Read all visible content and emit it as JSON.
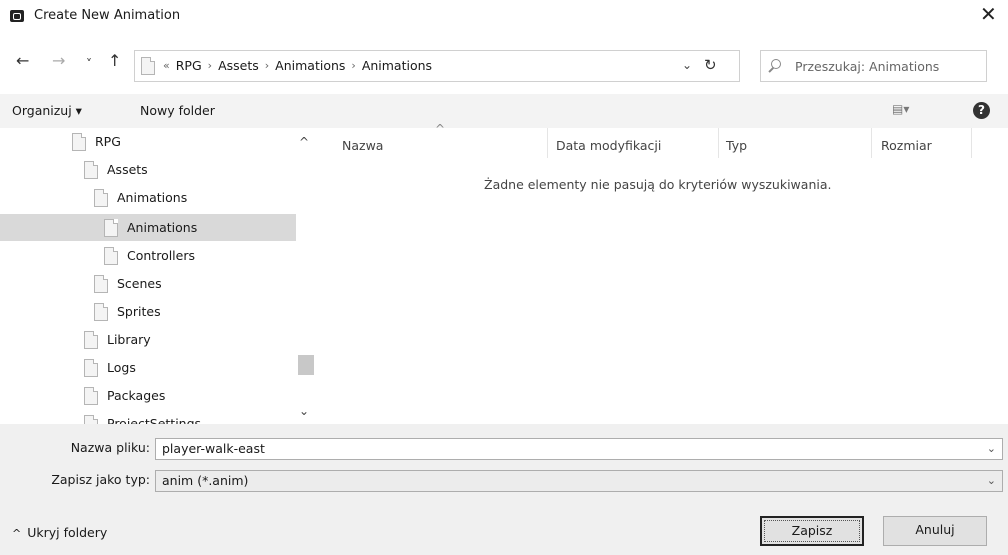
{
  "window": {
    "title": "Create New Animation",
    "close_glyph": "✕"
  },
  "nav": {
    "back": "←",
    "forward": "→",
    "recent": "˅",
    "up": "↑",
    "breadcrumbs": [
      "«",
      "RPG",
      "Assets",
      "Animations",
      "Animations"
    ],
    "separator": "›",
    "dropdown": "⌄",
    "refresh": "↻",
    "search_placeholder": "Przeszukaj: Animations"
  },
  "toolbar": {
    "organize": "Organizuj ▾",
    "new_folder": "Nowy folder",
    "view": "▤▾",
    "help": "?"
  },
  "tree": {
    "items": [
      {
        "label": "RPG"
      },
      {
        "label": "Assets"
      },
      {
        "label": "Animations"
      },
      {
        "label": "Animations",
        "selected": true
      },
      {
        "label": "Controllers"
      },
      {
        "label": "Scenes"
      },
      {
        "label": "Sprites"
      },
      {
        "label": "Library"
      },
      {
        "label": "Logs"
      },
      {
        "label": "Packages"
      },
      {
        "label": "ProjectSettings"
      }
    ],
    "scroll_up": "^",
    "scroll_down": "⌄"
  },
  "list": {
    "columns": [
      "Nazwa",
      "Data modyfikacji",
      "Typ",
      "Rozmiar"
    ],
    "sort_caret": "^",
    "empty_message": "Żadne elementy nie pasują do kryteriów wyszukiwania."
  },
  "form": {
    "filename_label": "Nazwa pliku:",
    "filename_value": "player-walk-east",
    "type_label": "Zapisz jako typ:",
    "type_value": "anim (*.anim)",
    "dropdown_glyph": "⌄",
    "hide_folders_caret": "^",
    "hide_folders": "Ukryj foldery",
    "save": "Zapisz",
    "cancel": "Anuluj"
  }
}
